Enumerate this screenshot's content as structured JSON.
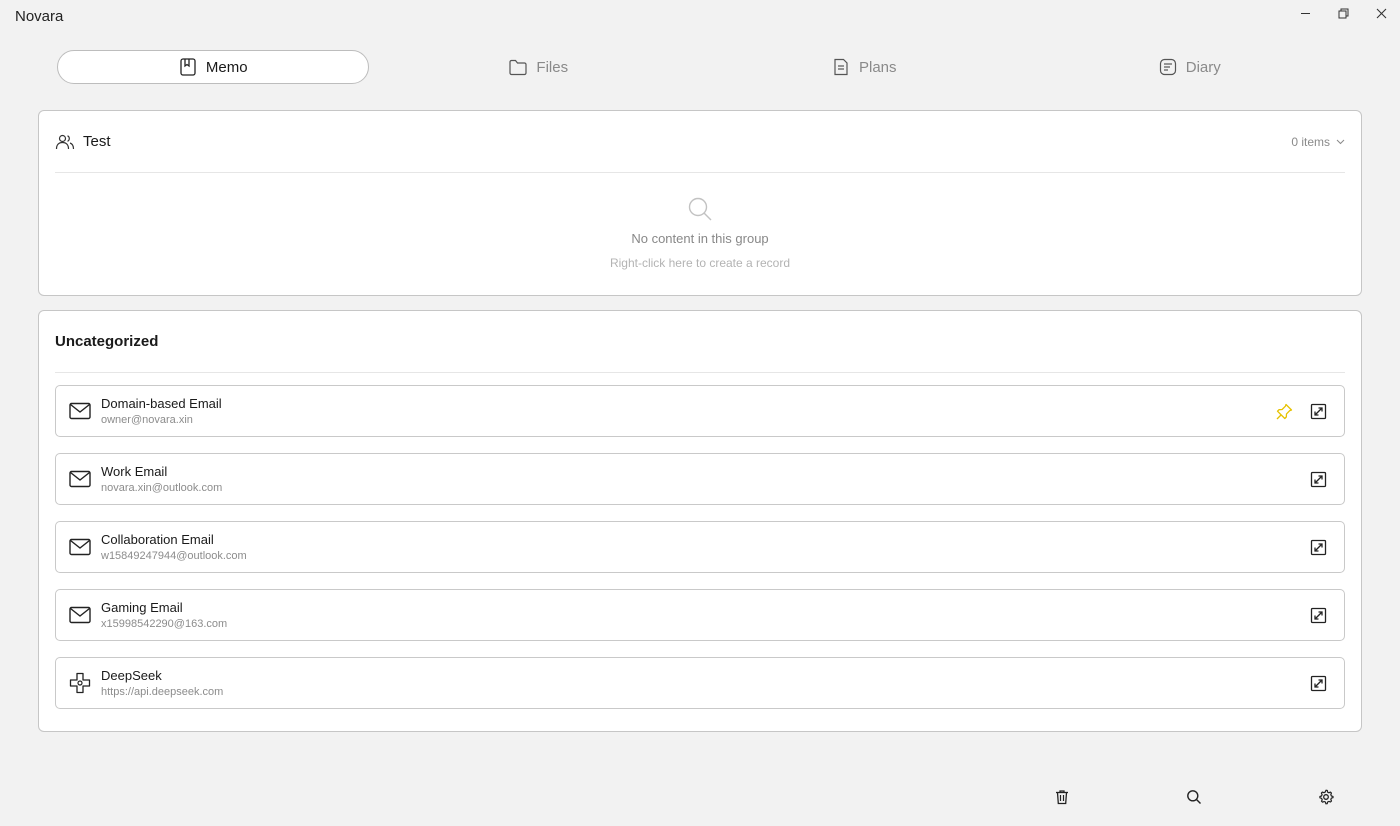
{
  "app": {
    "title": "Novara"
  },
  "tabs": [
    {
      "label": "Memo",
      "icon": "bookmark-icon",
      "active": true
    },
    {
      "label": "Files",
      "icon": "folder-icon",
      "active": false
    },
    {
      "label": "Plans",
      "icon": "document-icon",
      "active": false
    },
    {
      "label": "Diary",
      "icon": "note-icon",
      "active": false
    }
  ],
  "groups": {
    "test": {
      "title": "Test",
      "count": "0 items",
      "empty_title": "No content in this group",
      "empty_hint": "Right-click here to create a record"
    },
    "uncategorized": {
      "title": "Uncategorized",
      "records": [
        {
          "title": "Domain-based Email",
          "subtitle": "owner@novara.xin",
          "icon": "mail-icon",
          "pinned": true
        },
        {
          "title": "Work Email",
          "subtitle": "novara.xin@outlook.com",
          "icon": "mail-icon",
          "pinned": false
        },
        {
          "title": "Collaboration Email",
          "subtitle": "w15849247944@outlook.com",
          "icon": "mail-icon",
          "pinned": false
        },
        {
          "title": "Gaming Email",
          "subtitle": "x15998542290@163.com",
          "icon": "mail-icon",
          "pinned": false
        },
        {
          "title": "DeepSeek",
          "subtitle": "https://api.deepseek.com",
          "icon": "clover-icon",
          "pinned": false
        }
      ]
    }
  },
  "colors": {
    "pin": "#e6c200",
    "accent_border": "#bdbdbd"
  },
  "bottombar": [
    "trash-icon",
    "search-icon",
    "gear-icon"
  ]
}
